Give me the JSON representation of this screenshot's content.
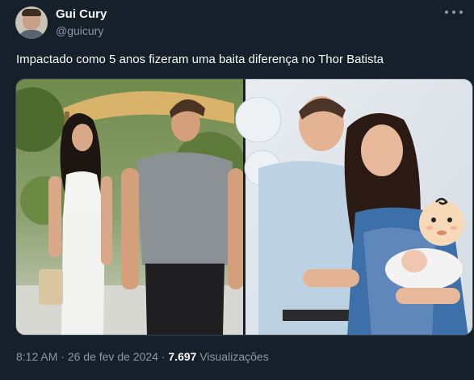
{
  "author": {
    "display_name": "Gui Cury",
    "handle": "@guicury",
    "avatar_icon": "user-avatar"
  },
  "tweet": {
    "text": "Impactado como 5 anos fizeram uma baita diferença no Thor Batista",
    "time": "8:12 AM",
    "date": "26 de fev de 2024",
    "separator": "·",
    "views_count": "7.697",
    "views_label": "Visualizações"
  },
  "media": {
    "left_photo": "couple-walking-photo",
    "right_photo": "family-baby-photo",
    "sticker_icon": "baby-emoji-icon"
  },
  "colors": {
    "background": "#15202b",
    "text_primary": "#f7f9f9",
    "text_secondary": "#8b98a5",
    "border": "#38444d"
  }
}
